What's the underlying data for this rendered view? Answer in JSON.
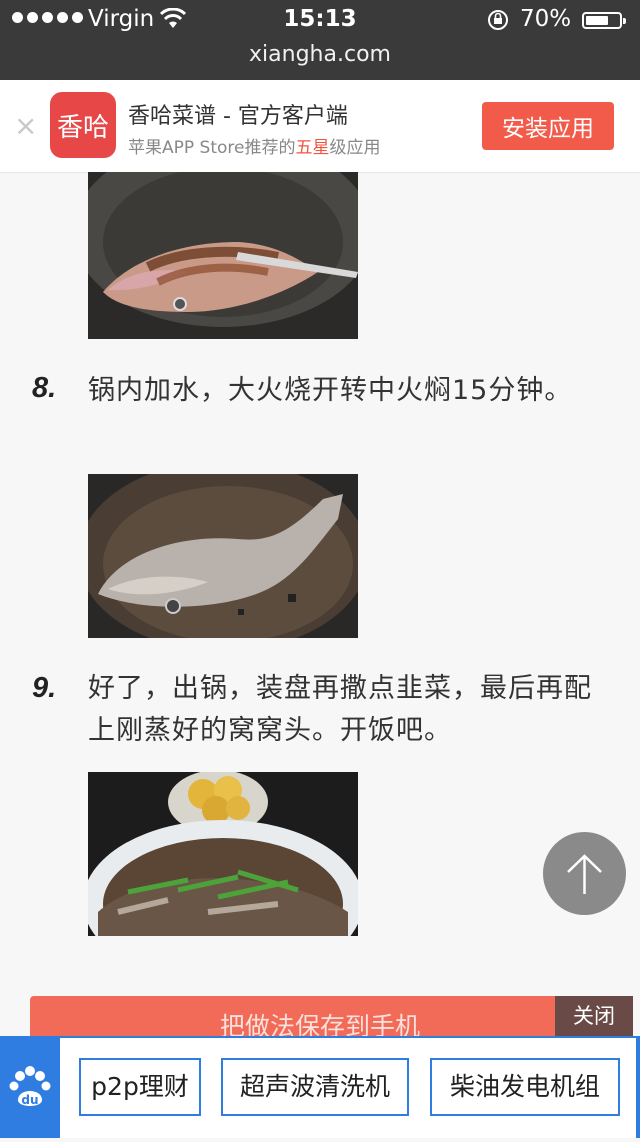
{
  "status_bar": {
    "carrier": "Virgin",
    "time": "15:13",
    "battery": "70%",
    "battery_level": 0.7
  },
  "browser": {
    "url": "xiangha.com"
  },
  "app_banner": {
    "logo_text": "香哈",
    "title": "香哈菜谱 - 官方客户端",
    "subtitle_pre": "苹果APP Store推荐的",
    "subtitle_highlight": "五星",
    "subtitle_post": "级应用",
    "install_label": "安装应用",
    "close_glyph": "×"
  },
  "steps": [
    {
      "number": "8.",
      "text": "锅内加水，大火烧开转中火焖15分钟。"
    },
    {
      "number": "9.",
      "text": "好了，出锅，装盘再撒点韭菜，最后再配上刚蒸好的窝窝头。开饭吧。"
    }
  ],
  "save_button": {
    "label": "把做法保存到手机"
  },
  "close_ad": {
    "label": "关闭"
  },
  "baidu_ad": {
    "logo_text": "du",
    "keywords": [
      "p2p理财",
      "超声波清洗机",
      "柴油发电机组"
    ]
  },
  "colors": {
    "accent": "#f25a4a",
    "ad_blue": "#2f7de1"
  }
}
